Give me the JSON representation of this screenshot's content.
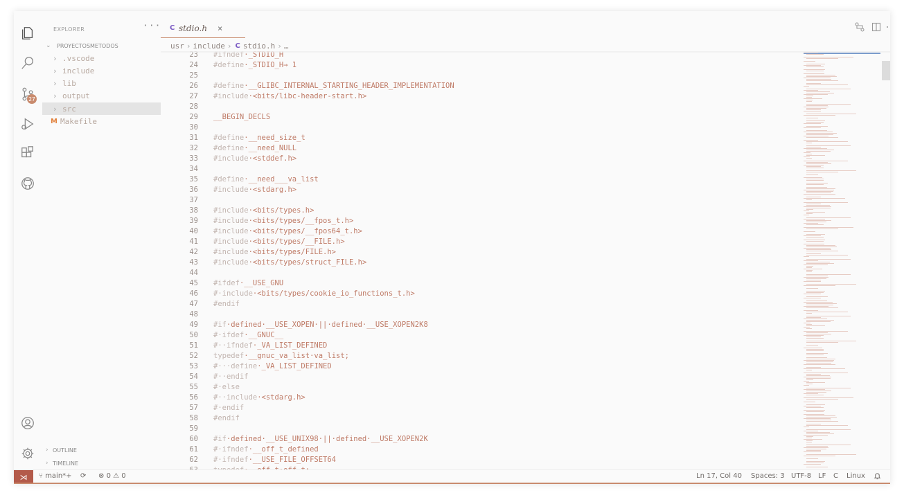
{
  "sidebar": {
    "header": "EXPLORER",
    "more": "···",
    "folder": "PROYECTOSMETODOS",
    "items": [
      {
        "label": ".vscode",
        "type": "folder"
      },
      {
        "label": "include",
        "type": "folder"
      },
      {
        "label": "lib",
        "type": "folder"
      },
      {
        "label": "output",
        "type": "folder"
      },
      {
        "label": "src",
        "type": "folder"
      },
      {
        "label": "Makefile",
        "type": "file",
        "icon": "M"
      }
    ],
    "outline": "OUTLINE",
    "timeline": "TIMELINE"
  },
  "activity": {
    "badge": "27"
  },
  "tab": {
    "icon": "C",
    "name": "stdio.h",
    "close": "×"
  },
  "breadcrumb": {
    "parts": [
      "usr",
      "include"
    ],
    "icon": "C",
    "file": "stdio.h",
    "tail": "…"
  },
  "code": [
    {
      "n": "23",
      "t": "#ifndef·_STDIO_H"
    },
    {
      "n": "24",
      "t": "#define·_STDIO_H→ 1"
    },
    {
      "n": "25",
      "t": ""
    },
    {
      "n": "26",
      "t": "#define·__GLIBC_INTERNAL_STARTING_HEADER_IMPLEMENTATION"
    },
    {
      "n": "27",
      "t": "#include·<bits/libc-header-start.h>"
    },
    {
      "n": "28",
      "t": ""
    },
    {
      "n": "29",
      "t": "__BEGIN_DECLS"
    },
    {
      "n": "30",
      "t": ""
    },
    {
      "n": "31",
      "t": "#define·__need_size_t"
    },
    {
      "n": "32",
      "t": "#define·__need_NULL"
    },
    {
      "n": "33",
      "t": "#include·<stddef.h>"
    },
    {
      "n": "34",
      "t": ""
    },
    {
      "n": "35",
      "t": "#define·__need___va_list"
    },
    {
      "n": "36",
      "t": "#include·<stdarg.h>"
    },
    {
      "n": "37",
      "t": ""
    },
    {
      "n": "38",
      "t": "#include·<bits/types.h>"
    },
    {
      "n": "39",
      "t": "#include·<bits/types/__fpos_t.h>"
    },
    {
      "n": "40",
      "t": "#include·<bits/types/__fpos64_t.h>"
    },
    {
      "n": "41",
      "t": "#include·<bits/types/__FILE.h>"
    },
    {
      "n": "42",
      "t": "#include·<bits/types/FILE.h>"
    },
    {
      "n": "43",
      "t": "#include·<bits/types/struct_FILE.h>"
    },
    {
      "n": "44",
      "t": ""
    },
    {
      "n": "45",
      "t": "#ifdef·__USE_GNU"
    },
    {
      "n": "46",
      "t": "#·include·<bits/types/cookie_io_functions_t.h>"
    },
    {
      "n": "47",
      "t": "#endif"
    },
    {
      "n": "48",
      "t": ""
    },
    {
      "n": "49",
      "t": "#if·defined·__USE_XOPEN·||·defined·__USE_XOPEN2K8"
    },
    {
      "n": "50",
      "t": "#·ifdef·__GNUC__"
    },
    {
      "n": "51",
      "t": "#··ifndef·_VA_LIST_DEFINED"
    },
    {
      "n": "52",
      "t": "typedef·__gnuc_va_list·va_list;"
    },
    {
      "n": "53",
      "t": "#···define·_VA_LIST_DEFINED"
    },
    {
      "n": "54",
      "t": "#··endif"
    },
    {
      "n": "55",
      "t": "#·else"
    },
    {
      "n": "56",
      "t": "#··include·<stdarg.h>"
    },
    {
      "n": "57",
      "t": "#·endif"
    },
    {
      "n": "58",
      "t": "#endif"
    },
    {
      "n": "59",
      "t": ""
    },
    {
      "n": "60",
      "t": "#if·defined·__USE_UNIX98·||·defined·__USE_XOPEN2K"
    },
    {
      "n": "61",
      "t": "#·ifndef·__off_t_defined"
    },
    {
      "n": "62",
      "t": "#·ifndef·__USE_FILE_OFFSET64"
    },
    {
      "n": "63",
      "t": "typedef·__off_t·off_t;"
    }
  ],
  "status": {
    "branch": "main*+",
    "errors": "0",
    "warnings": "0",
    "position": "Ln 17, Col 40",
    "spaces": "Spaces: 3",
    "encoding": "UTF-8",
    "eol": "LF",
    "language": "C",
    "os": "Linux"
  },
  "colors": {
    "accent": "#c98b6e",
    "code_text": "#bf7b67",
    "code_keyword": "#c3b6b1",
    "remote": "#b35a4a",
    "c_icon": "#7c5cc4",
    "makefile_icon": "#e2833f"
  }
}
